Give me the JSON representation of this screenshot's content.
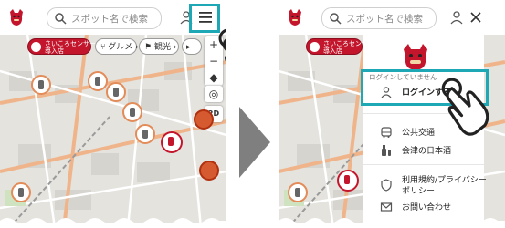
{
  "search": {
    "placeholder": "スポット名で検索"
  },
  "chips": {
    "primary_line1": "さいころセンサー",
    "primary_line2": "導入店",
    "gourmet": "グルメ",
    "sightseeing": "観光"
  },
  "map_controls": {
    "zoom_in": "+",
    "zoom_out": "−",
    "mode_2d": "2D"
  },
  "menu": {
    "login_status": "ログインしていません",
    "login_label": "ログインする",
    "items": [
      {
        "label": "公共交通",
        "icon": "bus-icon"
      },
      {
        "label": "会津の日本酒",
        "icon": "sake-bottle-icon"
      },
      {
        "label": "利用規約/プライバシー",
        "label2": "ポリシー",
        "icon": "shield-icon"
      },
      {
        "label": "お問い合わせ",
        "icon": "mail-icon"
      }
    ]
  },
  "colors": {
    "accent_teal": "#1ea7b5",
    "brand_red": "#c3162c",
    "pin_orange": "#e38b59",
    "arrow_gray": "#7f7f7f"
  }
}
